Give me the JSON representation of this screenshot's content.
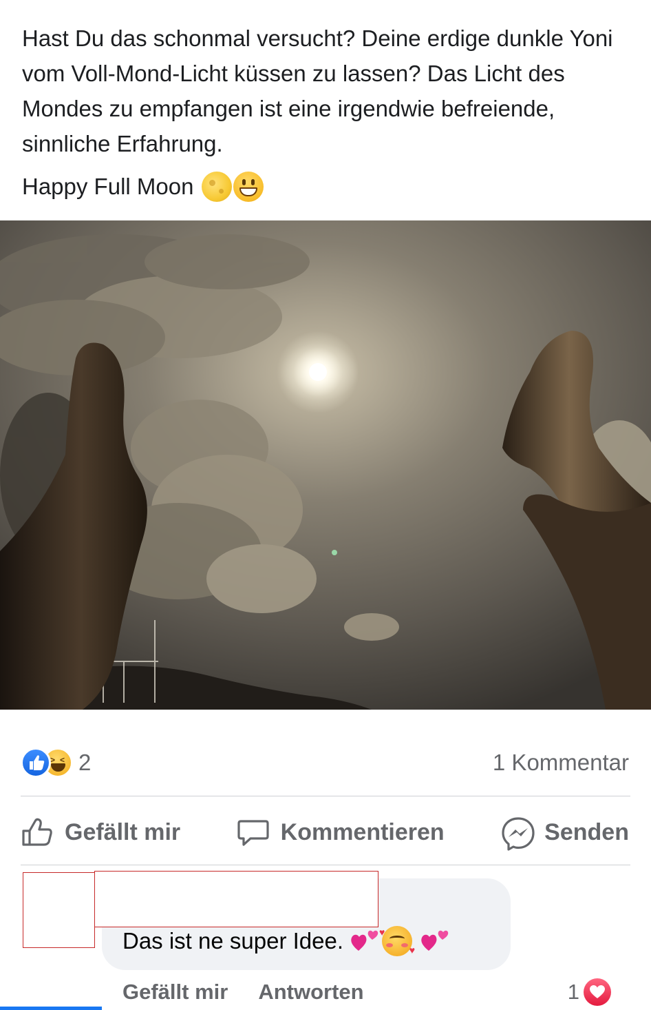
{
  "post": {
    "text_paragraph_1": "Hast Du das schonmal versucht? Deine erdige dunkle Yoni vom Voll-Mond-Licht küssen zu lassen? Das Licht des Mondes zu empfangen ist eine irgendwie befreiende, sinnliche Erfahrung.",
    "text_paragraph_2": "Happy Full Moon",
    "text_paragraph_2_emojis": [
      "full-moon-emoji",
      "grinning-face-emoji"
    ]
  },
  "reactions": {
    "icons": [
      "like-reaction-icon",
      "haha-reaction-icon"
    ],
    "count": "2",
    "comment_count_label": "1 Kommentar"
  },
  "actions": {
    "like_label": "Gefällt mir",
    "comment_label": "Kommentieren",
    "send_label": "Senden"
  },
  "comment": {
    "text": "Das ist ne super Idee.",
    "emojis": [
      "two-hearts-emoji",
      "smiling-face-with-hearts-emoji",
      "two-hearts-emoji"
    ],
    "like_label": "Gefällt mir",
    "reply_label": "Antworten",
    "reaction_count": "1",
    "reaction_icon": "love-reaction-icon"
  },
  "colors": {
    "text_primary": "#1c1e21",
    "text_secondary": "#65676b",
    "facebook_blue": "#1877f2",
    "comment_bubble": "#f0f2f5",
    "love_red": "#e41b3f",
    "redaction_border": "#c62828"
  }
}
